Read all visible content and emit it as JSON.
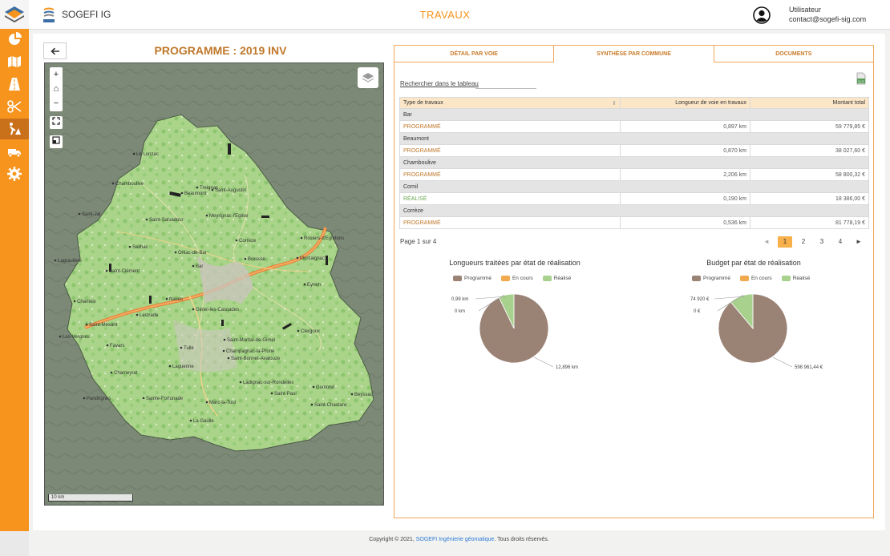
{
  "app": {
    "name": "SOGEFI IG",
    "page_title": "TRAVAUX"
  },
  "user": {
    "label": "Utilisateur",
    "email": "contact@sogefi-sig.com"
  },
  "sidebar": {
    "items": [
      {
        "name": "pie-chart-icon"
      },
      {
        "name": "map-icon"
      },
      {
        "name": "road-icon"
      },
      {
        "name": "scissors-icon"
      },
      {
        "name": "roadworks-icon",
        "active": true
      },
      {
        "name": "truck-icon"
      },
      {
        "name": "settings-icon"
      }
    ]
  },
  "program": {
    "title": "PROGRAMME : 2019 INV"
  },
  "map": {
    "controls": [
      "+",
      "⌂",
      "−"
    ],
    "scale": "10 km",
    "places": [
      "Le Lonzac",
      "Chamboulive",
      "Treignac",
      "Beaumont",
      "Saint-Augustin",
      "Saint-Salvadour",
      "Meyrignac-l'Eglise",
      "Saint-Jal",
      "Seilhac",
      "Orliac-de-Bar",
      "Corrèze",
      "Bar",
      "Rosiers-d'Egletons",
      "Montaignac",
      "Lagraulière",
      "Saint-Clément",
      "Brousse",
      "Eyrein",
      "Chanteix",
      "Naves",
      "Gimel-les-Cascades",
      "Saint-Mexant",
      "Lestrade",
      "Clergoux",
      "Les-Vergnes",
      "Favars",
      "Tulle",
      "Saint-Martial-de-Gimel",
      "Champagnac-la-Prune",
      "Saint-Bonnet-Avalouze",
      "Chameyrat",
      "Laguenne",
      "Ladignac-sur-Rondelles",
      "Gumond",
      "Sainte-Fortunade",
      "Saint-Paul",
      "Marc-la-Tour",
      "Beyssac",
      "Pandrignes",
      "La Gaulle",
      "Saint-Chastanc"
    ]
  },
  "tabs": [
    {
      "label": "DÉTAIL PAR VOIE",
      "active": false
    },
    {
      "label": "SYNTHÈSE PAR COMMUNE",
      "active": true
    },
    {
      "label": "DOCUMENTS",
      "active": false
    }
  ],
  "search": {
    "label": "Rechercher dans le tableau",
    "value": ""
  },
  "table": {
    "headers": [
      "Type de travaux",
      "Longueur de voie en travaux",
      "Montant total"
    ],
    "groups": [
      {
        "commune": "Bar",
        "type": "PROGRAMMÉ",
        "status": "programme",
        "length": "0,897 km",
        "amount": "59 779,85 €"
      },
      {
        "commune": "Beaumont",
        "type": "PROGRAMMÉ",
        "status": "programme",
        "length": "0,870 km",
        "amount": "38 027,60 €"
      },
      {
        "commune": "Chamboulive",
        "type": "PROGRAMMÉ",
        "status": "programme",
        "length": "2,206 km",
        "amount": "58 800,32 €"
      },
      {
        "commune": "Cornil",
        "type": "RÉALISÉ",
        "status": "realise",
        "length": "0,190 km",
        "amount": "18 386,00 €"
      },
      {
        "commune": "Corrèze",
        "type": "PROGRAMMÉ",
        "status": "programme",
        "length": "0,536 km",
        "amount": "81 778,19 €"
      }
    ]
  },
  "pagination": {
    "info": "Page 1 sur 4",
    "pages": [
      "1",
      "2",
      "3",
      "4"
    ],
    "current": "1",
    "prev": "◄",
    "next": "►"
  },
  "legend": [
    {
      "label": "Programmé",
      "color": "#9a8275"
    },
    {
      "label": "En cours",
      "color": "#f0a94e"
    },
    {
      "label": "Réalisé",
      "color": "#a9d18e"
    }
  ],
  "chart_data": [
    {
      "type": "pie",
      "title": "Longueurs traitées par état de réalisation",
      "categories": [
        "Programmé",
        "En cours",
        "Réalisé"
      ],
      "values": [
        12.896,
        0,
        0.99
      ],
      "labels": [
        "12,896 km",
        "0 km",
        "0,99 km"
      ],
      "colors": [
        "#9a8275",
        "#f0a94e",
        "#a9d18e"
      ]
    },
    {
      "type": "pie",
      "title": "Budget par état de réalisation",
      "categories": [
        "Programmé",
        "En cours",
        "Réalisé"
      ],
      "values": [
        598961.44,
        0,
        74920
      ],
      "labels": [
        "598 961,44 €",
        "0 €",
        "74 920 €"
      ],
      "colors": [
        "#9a8275",
        "#f0a94e",
        "#a9d18e"
      ]
    }
  ],
  "footer": {
    "prefix": "Copyright © 2021,",
    "link": "SOGEFI Ingénierie géomatique",
    "suffix": ". Tous droits réservés."
  }
}
